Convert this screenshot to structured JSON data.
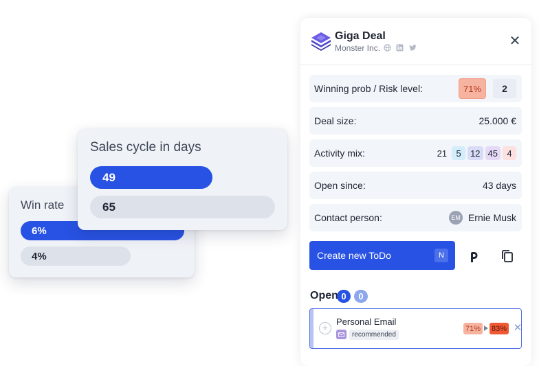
{
  "win_rate_card": {
    "title": "Win rate",
    "bars": [
      {
        "label": "6%",
        "value_pct": 6,
        "highlight": true
      },
      {
        "label": "4%",
        "value_pct": 4,
        "highlight": false
      }
    ]
  },
  "sales_cycle_card": {
    "title": "Sales cycle in days",
    "bars": [
      {
        "label": "49",
        "value": 49,
        "highlight": true
      },
      {
        "label": "65",
        "value": 65,
        "highlight": false
      }
    ]
  },
  "deal": {
    "title": "Giga Deal",
    "company": "Monster Inc.",
    "social_icons": [
      "globe-icon",
      "linkedin-icon",
      "twitter-icon"
    ],
    "close_icon": "close-icon",
    "rows": {
      "winning_prob": {
        "label": "Winning prob / Risk level:",
        "prob": "71%",
        "risk": "2"
      },
      "deal_size": {
        "label": "Deal size:",
        "value": "25.000 €"
      },
      "activity_mix": {
        "label": "Activity mix:",
        "values": [
          "21",
          "5",
          "12",
          "45",
          "4"
        ]
      },
      "open_since": {
        "label": "Open since:",
        "value": "43 days"
      },
      "contact_person": {
        "label": "Contact person:",
        "initials": "EM",
        "name": "Ernie Musk"
      }
    },
    "create_todo": {
      "label": "Create new ToDo",
      "shortcut": "N"
    },
    "actions": [
      "pipedrive-icon",
      "copy-icon"
    ],
    "open_section": {
      "label": "Open",
      "counts": [
        "0",
        "0"
      ],
      "tasks": [
        {
          "title": "Personal Email",
          "tag": "recommended",
          "from": "71%",
          "to": "83%"
        }
      ]
    }
  },
  "colors": {
    "accent": "#2752e3",
    "card_bg": "#eff2f7",
    "row_bg": "#f2f5f9",
    "prob_low": "#f6b4a0",
    "prob_high": "#ef5a35",
    "activity": [
      "#ffffff",
      "#d3edfb",
      "#d9dcf7",
      "#e6d9f5",
      "#fde0e0"
    ]
  }
}
